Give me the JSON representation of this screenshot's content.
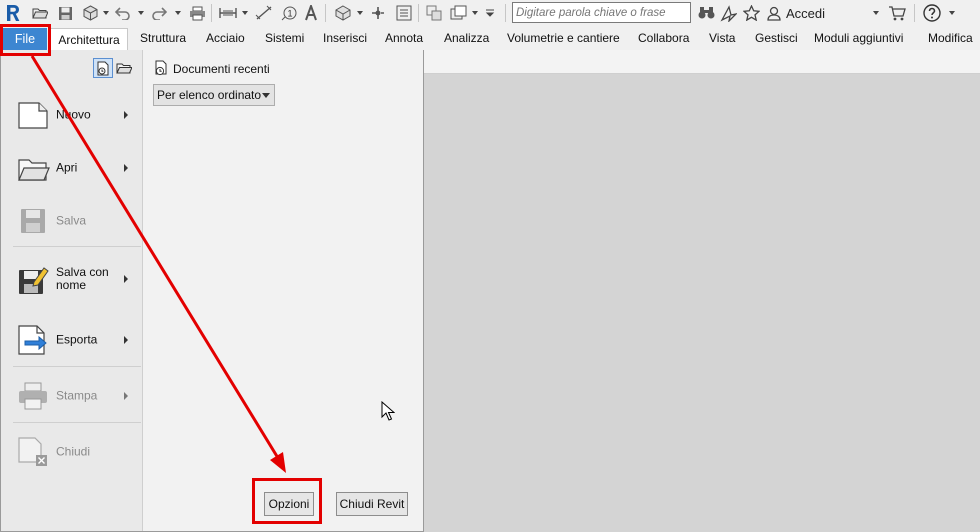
{
  "search": {
    "placeholder": "Digitare parola chiave o frase"
  },
  "header": {
    "login_label": "Accedi"
  },
  "tabs": [
    {
      "label": "File"
    },
    {
      "label": "Architettura"
    },
    {
      "label": "Struttura"
    },
    {
      "label": "Acciaio"
    },
    {
      "label": "Sistemi"
    },
    {
      "label": "Inserisci"
    },
    {
      "label": "Annota"
    },
    {
      "label": "Analizza"
    },
    {
      "label": "Volumetrie e cantiere"
    },
    {
      "label": "Collabora"
    },
    {
      "label": "Vista"
    },
    {
      "label": "Gestisci"
    },
    {
      "label": "Moduli aggiuntivi"
    },
    {
      "label": "Modifica"
    }
  ],
  "app_menu": {
    "items": [
      {
        "label": "Nuovo",
        "enabled": true,
        "submenu": true,
        "icon": "new-document-icon"
      },
      {
        "label": "Apri",
        "enabled": true,
        "submenu": true,
        "icon": "open-folder-icon"
      },
      {
        "label": "Salva",
        "enabled": false,
        "submenu": false,
        "icon": "save-icon"
      },
      {
        "label": "Salva con\nnome",
        "enabled": true,
        "submenu": true,
        "icon": "save-as-icon"
      },
      {
        "label": "Esporta",
        "enabled": true,
        "submenu": true,
        "icon": "export-icon"
      },
      {
        "label": "Stampa",
        "enabled": false,
        "submenu": true,
        "icon": "print-icon"
      },
      {
        "label": "Chiudi",
        "enabled": false,
        "submenu": false,
        "icon": "close-document-icon"
      }
    ],
    "recent": {
      "title": "Documenti recenti",
      "sort_value": "Per elenco ordinato"
    },
    "options_label": "Opzioni",
    "exit_label": "Chiudi Revit"
  },
  "colors": {
    "file_tab": "#3d86d1",
    "annotation_red": "#e30000",
    "revit_blue": "#1a5ca8"
  }
}
